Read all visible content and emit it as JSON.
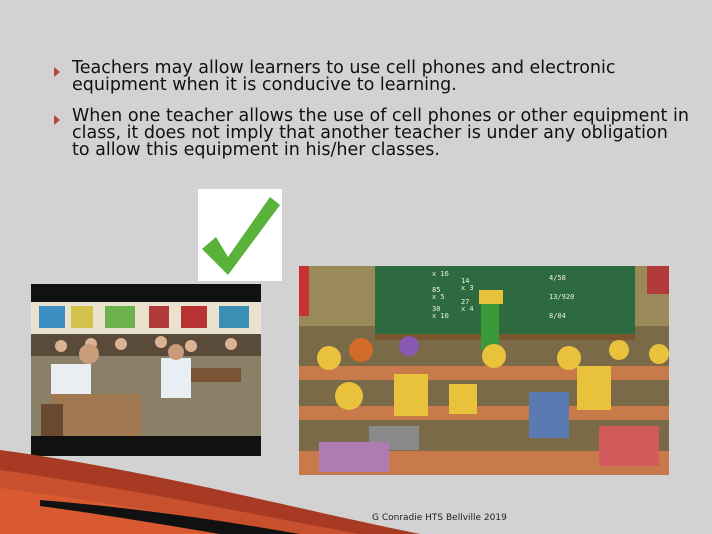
{
  "bullets": [
    "Teachers may allow learners to use cell phones and electronic equipment when it is conducive to learning.",
    "When one teacher allows the use of cell phones or other equipment in class, it does not imply that another teacher is under any obligation to allow this equipment in his/her classes."
  ],
  "icons": {
    "bullet": "triangle-right-icon",
    "check": "checkmark-icon"
  },
  "colors": {
    "accent": "#b6462f",
    "check": "#59b23a",
    "background": "#d2d2d2"
  },
  "cartoon": {
    "board_left": [
      "x 16",
      "85",
      "x 5",
      "30",
      "x 10"
    ],
    "board_mid": [
      "14",
      "x 3",
      "27",
      "x 4"
    ],
    "board_right": [
      "4/58",
      "13/920",
      "8/84"
    ]
  },
  "footer": "G Conradie HTS Bellville 2019"
}
